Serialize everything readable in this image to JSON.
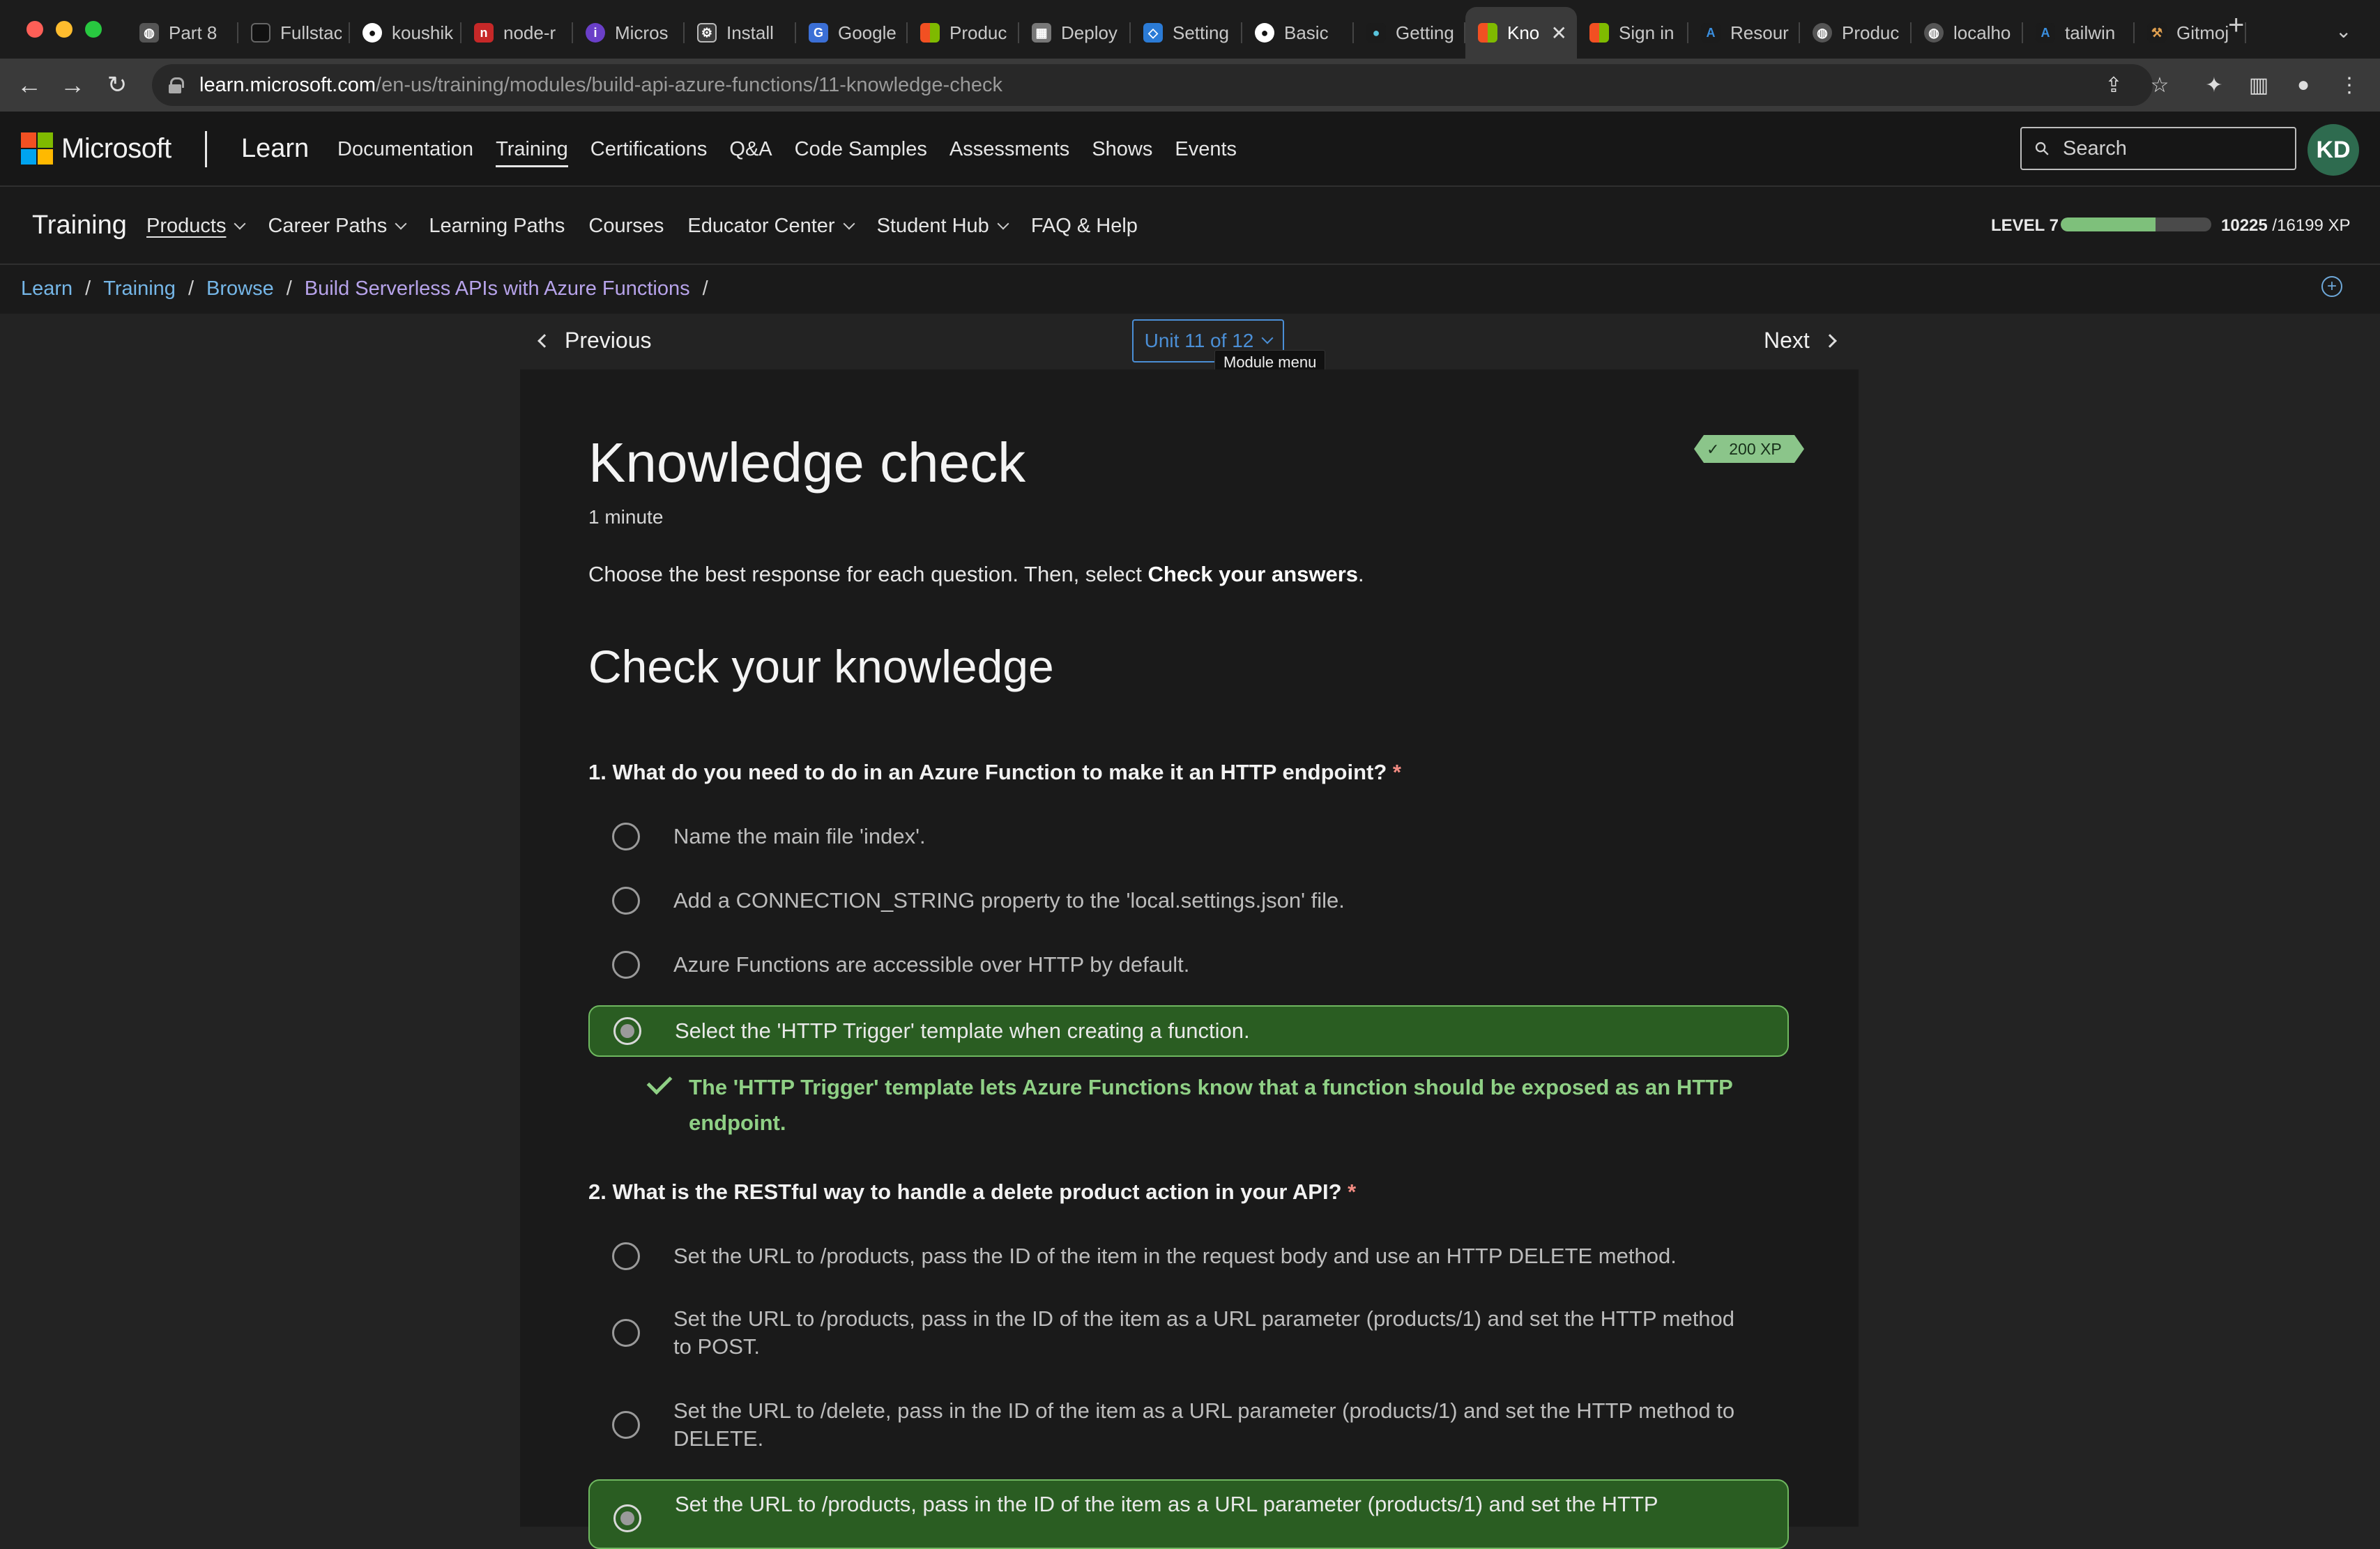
{
  "browser": {
    "tabs": [
      {
        "label": "Part 8",
        "icon": "globe-icon",
        "active": false
      },
      {
        "label": "Fullstack",
        "icon": "fullstack-icon",
        "active": false
      },
      {
        "label": "koushik",
        "icon": "github-icon",
        "active": false
      },
      {
        "label": "node-r",
        "icon": "npm-icon",
        "active": false
      },
      {
        "label": "Micros",
        "icon": "microsoft-icon",
        "active": false
      },
      {
        "label": "Install",
        "icon": "chatgpt-icon",
        "active": false
      },
      {
        "label": "Google",
        "icon": "translate-icon",
        "active": false
      },
      {
        "label": "Produc",
        "icon": "microsoft-icon",
        "active": false
      },
      {
        "label": "Deploy",
        "icon": "deploy-icon",
        "active": false
      },
      {
        "label": "Setting",
        "icon": "vscode-icon",
        "active": false
      },
      {
        "label": "Basic",
        "icon": "github-icon",
        "active": false
      },
      {
        "label": "Getting",
        "icon": "react-icon",
        "active": false
      },
      {
        "label": "Kno",
        "icon": "microsoft-icon",
        "active": true
      },
      {
        "label": "Sign in",
        "icon": "microsoft-icon",
        "active": false
      },
      {
        "label": "Resour",
        "icon": "azure-icon",
        "active": false
      },
      {
        "label": "Produc",
        "icon": "globe-icon",
        "active": false
      },
      {
        "label": "localho",
        "icon": "globe-icon",
        "active": false
      },
      {
        "label": "tailwin",
        "icon": "azure-icon",
        "active": false
      },
      {
        "label": "Gitmoj",
        "icon": "tools-icon",
        "active": false
      }
    ],
    "url_host": "learn.microsoft.com",
    "url_path": "/en-us/training/modules/build-api-azure-functions/11-knowledge-check"
  },
  "header": {
    "brand": "Microsoft",
    "product": "Learn",
    "nav": [
      {
        "label": "Documentation",
        "active": false
      },
      {
        "label": "Training",
        "active": true
      },
      {
        "label": "Certifications",
        "active": false
      },
      {
        "label": "Q&A",
        "active": false
      },
      {
        "label": "Code Samples",
        "active": false
      },
      {
        "label": "Assessments",
        "active": false
      },
      {
        "label": "Shows",
        "active": false
      },
      {
        "label": "Events",
        "active": false
      }
    ],
    "search_placeholder": "Search",
    "avatar_initials": "KD"
  },
  "subnav": {
    "title": "Training",
    "items": [
      {
        "label": "Products",
        "dropdown": true,
        "active": true
      },
      {
        "label": "Career Paths",
        "dropdown": true,
        "active": false
      },
      {
        "label": "Learning Paths",
        "dropdown": false,
        "active": false
      },
      {
        "label": "Courses",
        "dropdown": false,
        "active": false
      },
      {
        "label": "Educator Center",
        "dropdown": true,
        "active": false
      },
      {
        "label": "Student Hub",
        "dropdown": true,
        "active": false
      },
      {
        "label": "FAQ & Help",
        "dropdown": false,
        "active": false
      }
    ],
    "level_label": "LEVEL 7",
    "xp_current": "10225",
    "xp_total": "/16199 XP",
    "level_progress": 0.63
  },
  "breadcrumb": [
    "Learn",
    "Training",
    "Browse",
    "Build Serverless APIs with Azure Functions"
  ],
  "unit_nav": {
    "previous": "Previous",
    "next": "Next",
    "unit": "Unit 11 of 12",
    "tooltip": "Module menu"
  },
  "content": {
    "title": "Knowledge check",
    "duration": "1 minute",
    "xp_badge": "200 XP",
    "instructions_prefix": "Choose the best response for each question. Then, select ",
    "instructions_bold": "Check your answers",
    "instructions_suffix": ".",
    "section_title": "Check your knowledge",
    "questions": [
      {
        "text": "1. What do you need to do in an Azure Function to make it an HTTP endpoint?",
        "required_mark": "*",
        "options": [
          "Name the main file 'index'.",
          "Add a CONNECTION_STRING property to the 'local.settings.json' file.",
          "Azure Functions are accessible over HTTP by default.",
          "Select the 'HTTP Trigger' template when creating a function."
        ],
        "selected_index": 3,
        "feedback": "The 'HTTP Trigger' template lets Azure Functions know that a function should be exposed as an HTTP endpoint."
      },
      {
        "text": "2. What is the RESTful way to handle a delete product action in your API?",
        "required_mark": "*",
        "options": [
          "Set the URL to /products, pass the ID of the item in the request body and use an HTTP DELETE method.",
          "Set the URL to /products, pass in the ID of the item as a URL parameter (products/1) and set the HTTP method to POST.",
          "Set the URL to /delete, pass in the ID of the item as a URL parameter (products/1) and set the HTTP method to DELETE.",
          "Set the URL to /products, pass in the ID of the item as a URL parameter (products/1) and set the HTTP"
        ],
        "selected_index": 3
      }
    ]
  },
  "colors": {
    "accent_blue": "#4b8fd6",
    "link_blue": "#75b6e7",
    "visited_purple": "#b7a3ea",
    "correct_green": "#2a5d22",
    "feedback_green": "#8fd085"
  }
}
